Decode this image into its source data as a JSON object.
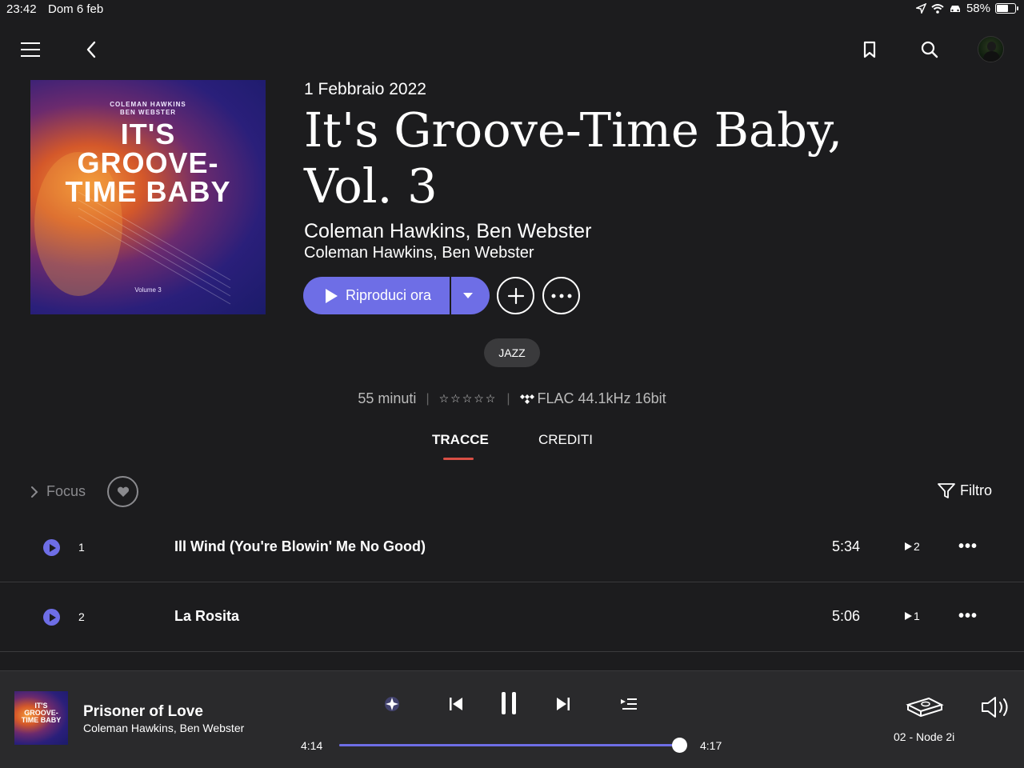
{
  "status_bar": {
    "time": "23:42",
    "date": "Dom 6 feb",
    "battery": "58%"
  },
  "album": {
    "cover": {
      "line1": "COLEMAN HAWKINS",
      "line2": "BEN WEBSTER",
      "title": "IT'S GROOVE- TIME BABY",
      "volume": "Volume 3"
    },
    "release_date": "1 Febbraio 2022",
    "title": "It's Groove-Time Baby, Vol. 3",
    "artist_primary": "Coleman Hawkins, Ben Webster",
    "artist_secondary": "Coleman Hawkins, Ben Webster",
    "genre": "JAZZ",
    "duration": "55 minuti",
    "rating_stars": "☆☆☆☆☆",
    "quality": "FLAC 44.1kHz 16bit"
  },
  "actions": {
    "play_now": "Riproduci ora"
  },
  "tabs": [
    {
      "label": "TRACCE",
      "active": true
    },
    {
      "label": "CREDITI",
      "active": false
    }
  ],
  "filters": {
    "focus": "Focus",
    "filter": "Filtro"
  },
  "tracks": [
    {
      "number": "1",
      "name": "Ill Wind (You're Blowin' Me No Good)",
      "duration": "5:34",
      "plays": "2",
      "more": "•••"
    },
    {
      "number": "2",
      "name": "La Rosita",
      "duration": "5:06",
      "plays": "1",
      "more": "•••"
    }
  ],
  "now_playing": {
    "cover_text": "IT'S GROOVE- TIME BABY",
    "title": "Prisoner of Love",
    "artist": "Coleman Hawkins, Ben Webster",
    "elapsed": "4:14",
    "total": "4:17",
    "progress": 0.988,
    "device": "02 - Node 2i"
  },
  "colors": {
    "accent": "#6e6ee6",
    "tab_underline": "#d94f45",
    "background": "#1c1c1e",
    "player_background": "#2a2a2c"
  },
  "icons": [
    "menu-icon",
    "back-icon",
    "bookmark-icon",
    "search-icon",
    "plus-icon",
    "more-icon",
    "heart-icon",
    "filter-icon",
    "previous-icon",
    "pause-icon",
    "next-icon",
    "queue-icon",
    "radio-icon",
    "device-icon",
    "volume-icon"
  ]
}
